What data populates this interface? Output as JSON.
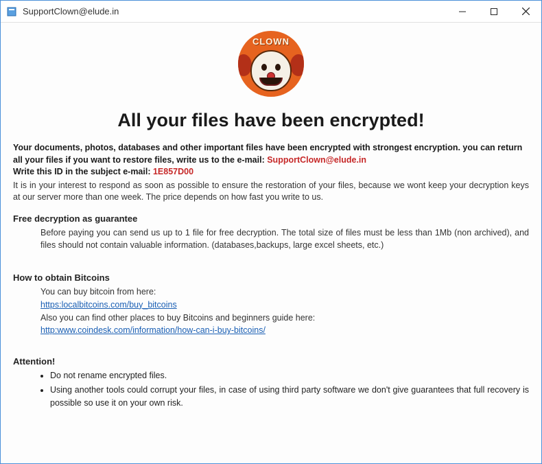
{
  "window": {
    "title": "SupportClown@elude.in"
  },
  "logo": {
    "label": "CLOWN"
  },
  "heading": "All your files have been encrypted!",
  "intro": {
    "line1a": "Your documents, photos, databases and other important files have been encrypted with strongest encryption. you can return all your files if you want to restore files, write us to the e-mail:  ",
    "email": "SupportClown@elude.in",
    "line2a": "Write this ID in the subject e-mail: ",
    "id": "1E857D00"
  },
  "respond": "It is in your interest to respond as soon as possible to ensure the restoration of your files, because we wont keep your decryption keys at our server more than one week. The price depends on how fast you write to us.",
  "guarantee": {
    "title": "Free decryption as guarantee",
    "body": "Before paying you can send us up to 1 file for free decryption. The total size of files must be less than 1Mb (non archived), and files should not contain valuable information. (databases,backups, large excel sheets, etc.)"
  },
  "bitcoins": {
    "title": "How to obtain Bitcoins",
    "line1": "You can buy bitcoin from here:",
    "link1": "https:localbitcoins.com/buy_bitcoins",
    "line2": "Also you can find other places to buy Bitcoins and beginners guide here:",
    "link2": "http:www.coindesk.com/information/how-can-i-buy-bitcoins/"
  },
  "attention": {
    "title": "Attention!",
    "items": [
      "Do not rename encrypted files.",
      "Using another tools could corrupt your files, in case of using third party software we don't give guarantees that full recovery is possible so use it on your own risk."
    ]
  }
}
